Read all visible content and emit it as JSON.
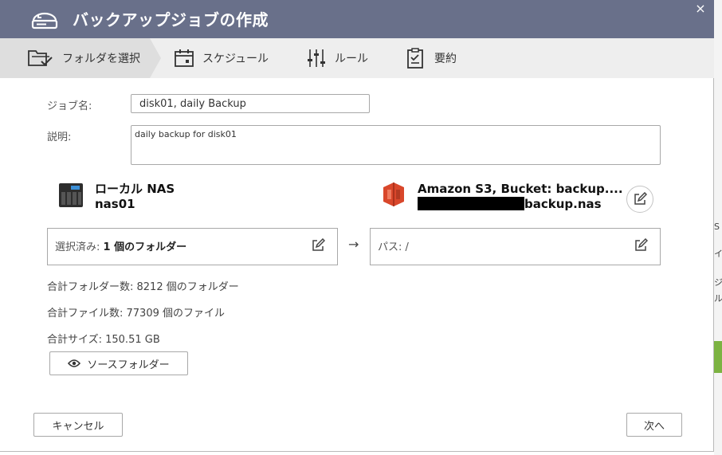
{
  "dialog": {
    "title": "バックアップジョブの作成",
    "close_label": "×"
  },
  "steps": [
    {
      "label": "フォルダを選択",
      "icon": "folder-check-icon"
    },
    {
      "label": "スケジュール",
      "icon": "calendar-icon"
    },
    {
      "label": "ルール",
      "icon": "sliders-icon"
    },
    {
      "label": "要約",
      "icon": "clipboard-icon"
    }
  ],
  "form": {
    "job_name_label": "ジョブ名:",
    "job_name_value": "disk01, daily Backup",
    "description_label": "説明:",
    "description_value": "daily backup for disk01"
  },
  "source": {
    "title": "ローカル NAS",
    "name": "nas01",
    "selection_prefix": "選択済み: ",
    "selection_value": "1 個のフォルダー"
  },
  "destination": {
    "title": "Amazon S3, Bucket: backup....",
    "name_suffix": "backup.nas",
    "path_value": "パス: /"
  },
  "arrow": "→",
  "stats": {
    "folders": "合計フォルダー数: 8212 個のフォルダー",
    "files": "合計ファイル数: 77309 個のファイル",
    "size": "合計サイズ: 150.51 GB"
  },
  "buttons": {
    "source_folder": "ソースフォルダー",
    "cancel": "キャンセル",
    "next": "次へ"
  },
  "colors": {
    "titlebar": "#69708a",
    "aws_red": "#d9472b",
    "step_active": "#dedede"
  },
  "background_glyphs": [
    "S",
    "イ",
    "ジ",
    "ル"
  ]
}
